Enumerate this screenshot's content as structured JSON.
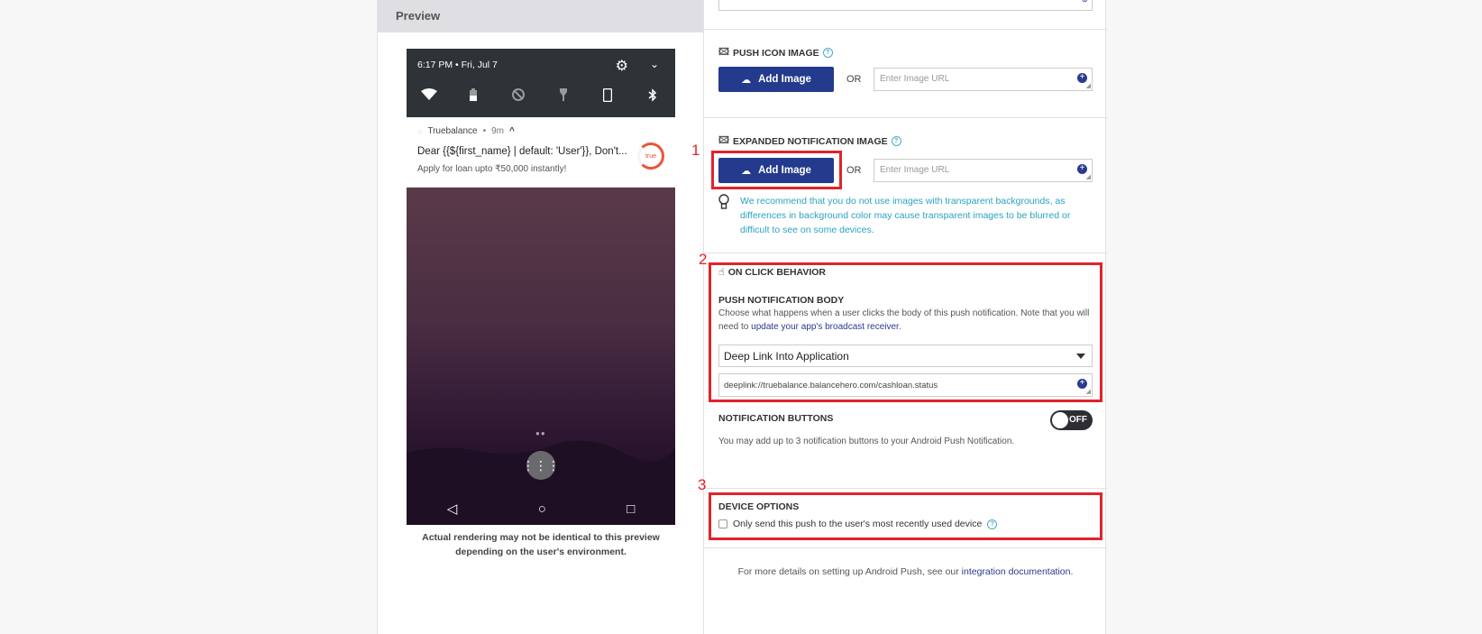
{
  "preview": {
    "header": "Preview",
    "phone": {
      "time": "6:17 PM",
      "date_separator": "•",
      "date": "Fri, Jul 7",
      "quick_settings_icons": [
        "wifi-icon",
        "battery-icon",
        "data-off-icon",
        "flashlight-icon",
        "phone-icon",
        "bluetooth-icon"
      ],
      "notification": {
        "app_name": "Truebalance",
        "age_separator": "•",
        "age": "9m",
        "title": "Dear {{${first_name} | default: 'User'}}, Don't...",
        "body": "Apply for loan upto ₹50,000 instantly!",
        "logo_text": "true"
      }
    },
    "note": "Actual rendering may not be identical to this preview depending on the user's environment."
  },
  "settings": {
    "push_icon": {
      "title": "PUSH ICON IMAGE",
      "button": "Add Image",
      "or": "OR",
      "url_placeholder": "Enter Image URL"
    },
    "expanded_image": {
      "title": "EXPANDED NOTIFICATION IMAGE",
      "button": "Add Image",
      "or": "OR",
      "url_placeholder": "Enter Image URL",
      "tip": "We recommend that you do not use images with transparent backgrounds, as differences in background color may cause transparent images to be blurred or difficult to see on some devices."
    },
    "on_click": {
      "title": "ON CLICK BEHAVIOR",
      "body_heading": "PUSH NOTIFICATION BODY",
      "body_desc": "Choose what happens when a user clicks the body of this push notification. Note that you will need to",
      "body_link": "update your app's broadcast receiver",
      "body_desc_end": ".",
      "selected_action": "Deep Link Into Application",
      "deeplink_value": "deeplink://truebalance.balancehero.com/cashloan.status"
    },
    "notification_buttons": {
      "title": "NOTIFICATION BUTTONS",
      "toggle_label": "OFF",
      "desc": "You may add up to 3 notification buttons to your Android Push Notification."
    },
    "device_options": {
      "title": "DEVICE OPTIONS",
      "checkbox_label": "Only send this push to the user's most recently used device"
    },
    "footer": {
      "text": "For more details on setting up Android Push, see our",
      "link": "integration documentation",
      "end": "."
    }
  },
  "annotations": {
    "labels": [
      "1",
      "2",
      "3"
    ],
    "color": "#e3222a"
  },
  "colors": {
    "primary_button": "#243a8c",
    "tip_text": "#2aa3c0",
    "link": "#2a3a8f"
  }
}
